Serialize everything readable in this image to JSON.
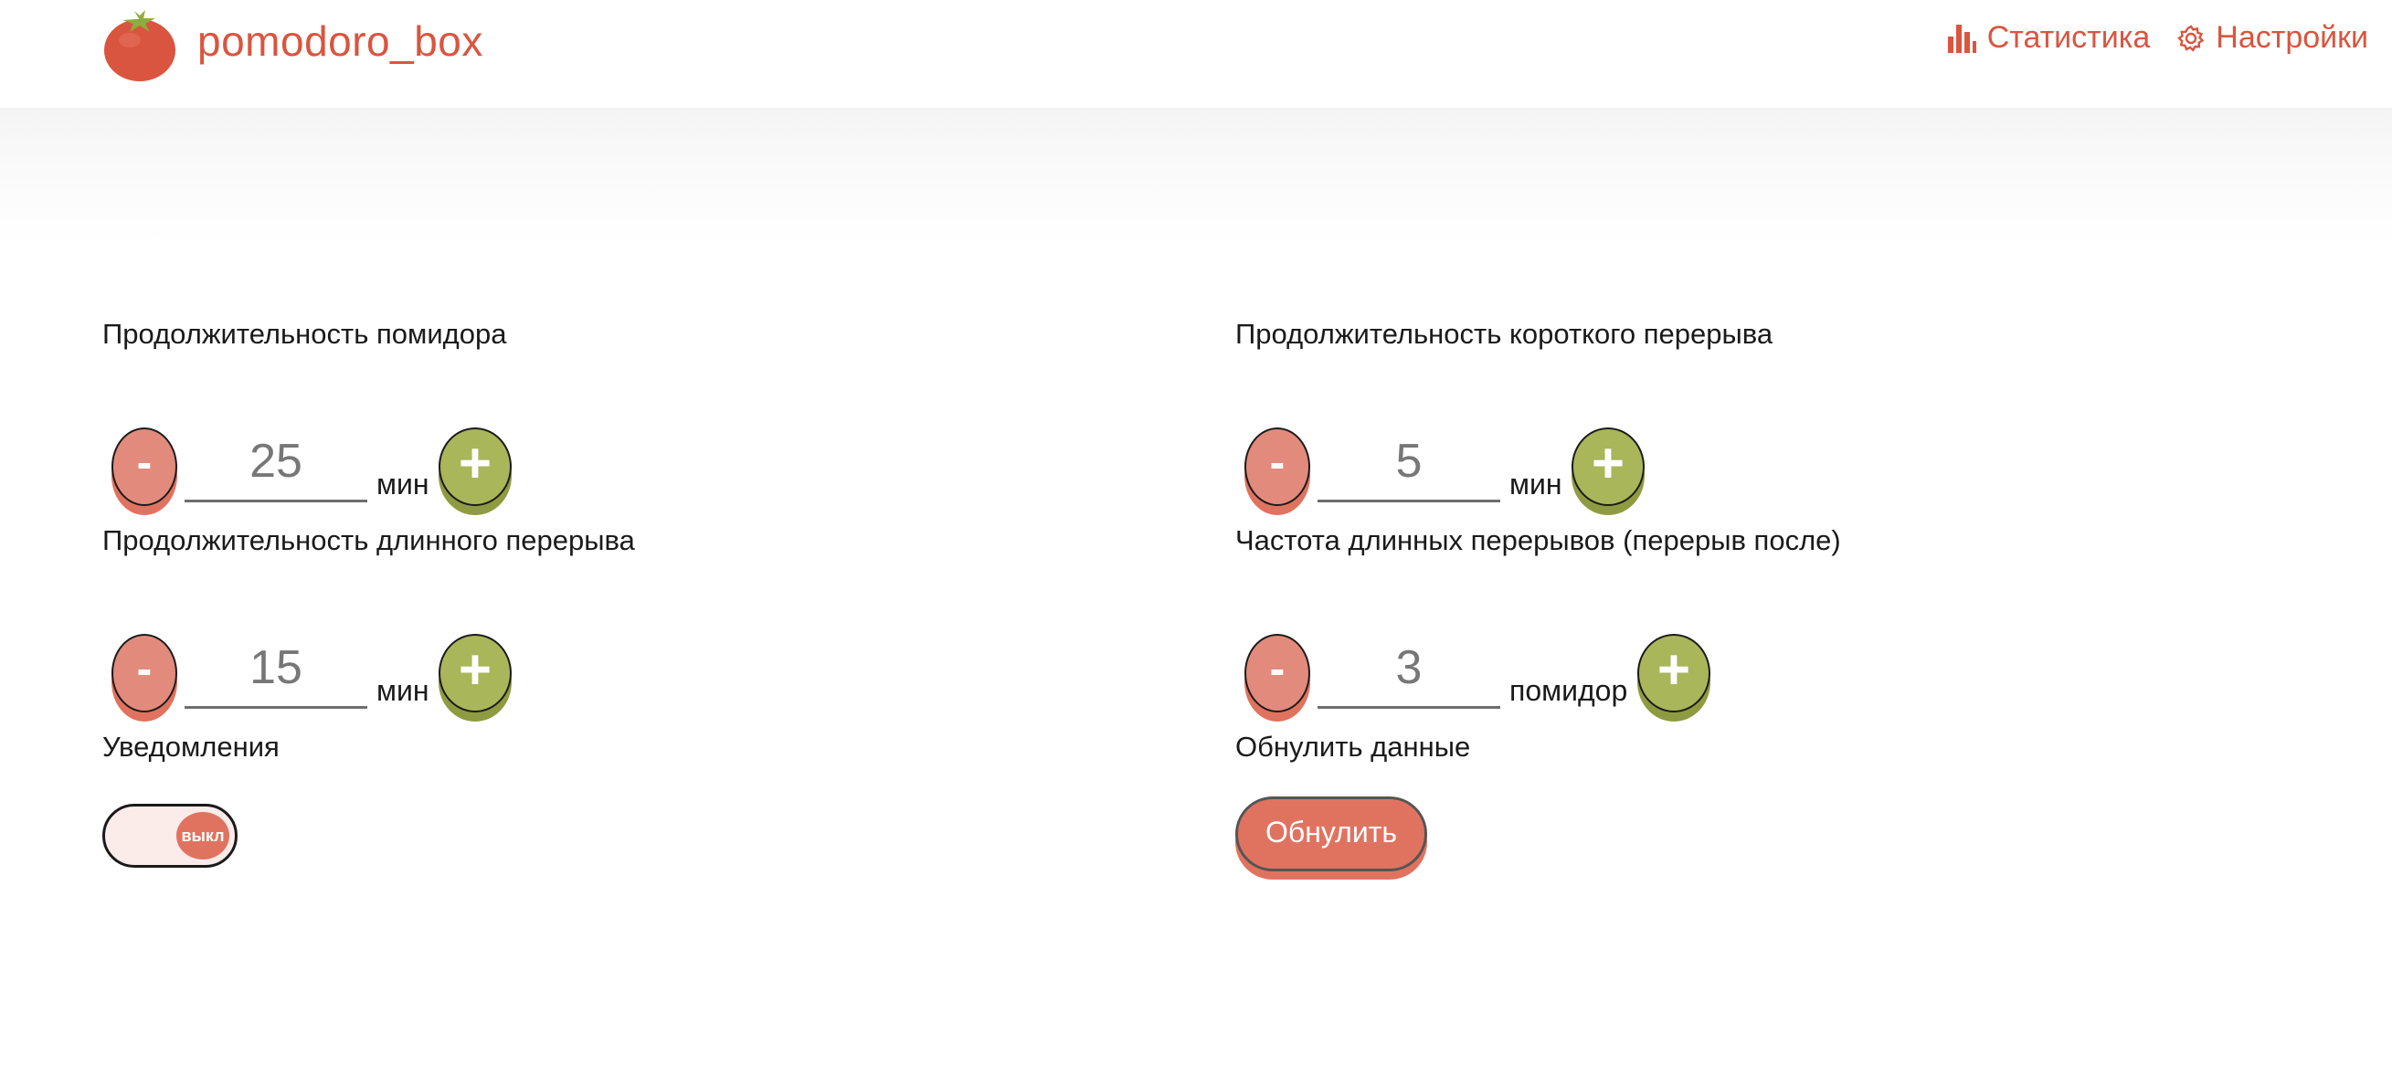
{
  "header": {
    "brand": "pomodoro_box",
    "nav": {
      "stats_label": "Статистика",
      "settings_label": "Настройки"
    }
  },
  "colors": {
    "accent": "#d9553f",
    "minus_button": "#e28a7c",
    "plus_button": "#a9b659",
    "toggle_knob": "#e07360"
  },
  "settings": {
    "pomodoro_duration": {
      "label": "Продолжительность помидора",
      "value": "25",
      "unit": "мин",
      "minus": "-",
      "plus": "+"
    },
    "short_break": {
      "label": "Продолжительность короткого перерыва",
      "value": "5",
      "unit": "мин",
      "minus": "-",
      "plus": "+"
    },
    "long_break": {
      "label": "Продолжительность длинного перерыва",
      "value": "15",
      "unit": "мин",
      "minus": "-",
      "plus": "+"
    },
    "long_break_frequency": {
      "label": "Частота длинных перерывов (перерыв после)",
      "value": "3",
      "unit": "помидор",
      "minus": "-",
      "plus": "+"
    },
    "notifications": {
      "label": "Уведомления",
      "state": "выкл"
    },
    "reset": {
      "label": "Обнулить данные",
      "button": "Обнулить"
    }
  }
}
